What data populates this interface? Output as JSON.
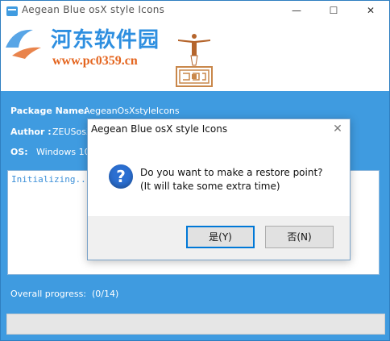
{
  "window": {
    "title": "Aegean Blue osX style Icons"
  },
  "watermark": {
    "title": "河东软件园",
    "url": "www.pc0359.cn"
  },
  "info": {
    "package_label": "Package Name:",
    "package_value": "AegeanOsXstyleIcons",
    "author_label": "Author :",
    "author_value": "ZEUSosX",
    "os_label": "OS:",
    "os_value": "Windows 10"
  },
  "log": {
    "text": "Initializing..."
  },
  "progress": {
    "label": "Overall progress:",
    "value": "(0/14)",
    "fraction": 0.0
  },
  "dialog": {
    "title": "Aegean Blue osX style Icons",
    "icon": "?",
    "message_line1": "Do you want to make a restore point?",
    "message_line2": "(It will take some extra time)",
    "yes_label": "是(Y)",
    "no_label": "否(N)"
  },
  "colors": {
    "accent": "#3f9be0",
    "log_text": "#3b8fd8",
    "dialog_border": "#7aa3c9"
  }
}
